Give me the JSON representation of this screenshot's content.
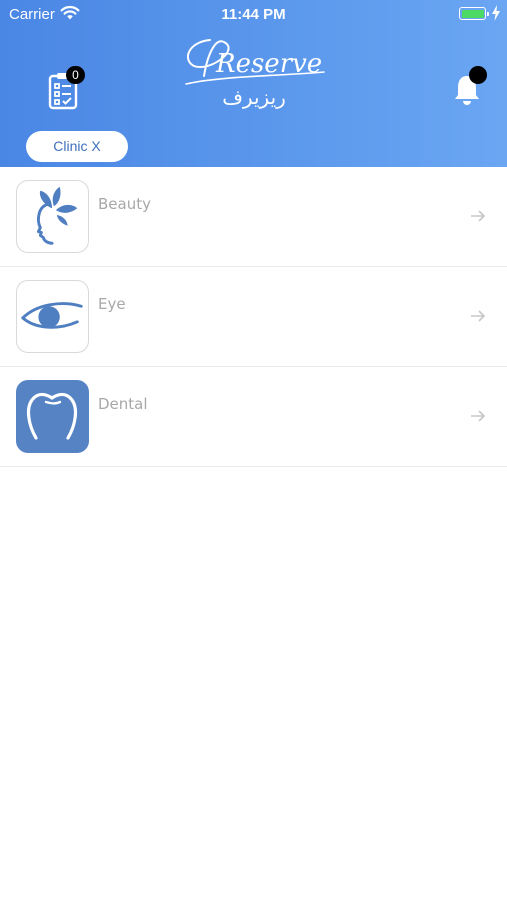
{
  "status_bar": {
    "carrier": "Carrier",
    "time": "11:44 PM"
  },
  "header": {
    "cart_badge": "0",
    "logo_text": "Reserve",
    "logo_arabic": "ريزيرف",
    "clinic_button": "Clinic  X"
  },
  "categories": [
    {
      "label": "Beauty",
      "icon": "beauty-face-icon"
    },
    {
      "label": "Eye",
      "icon": "eye-icon"
    },
    {
      "label": "Dental",
      "icon": "tooth-icon"
    }
  ],
  "colors": {
    "header_gradient_start": "#4a86e4",
    "header_gradient_end": "#6aa6f2",
    "icon_blue": "#5583c4",
    "label_gray": "#a8a8a8",
    "battery_green": "#4cd964"
  }
}
